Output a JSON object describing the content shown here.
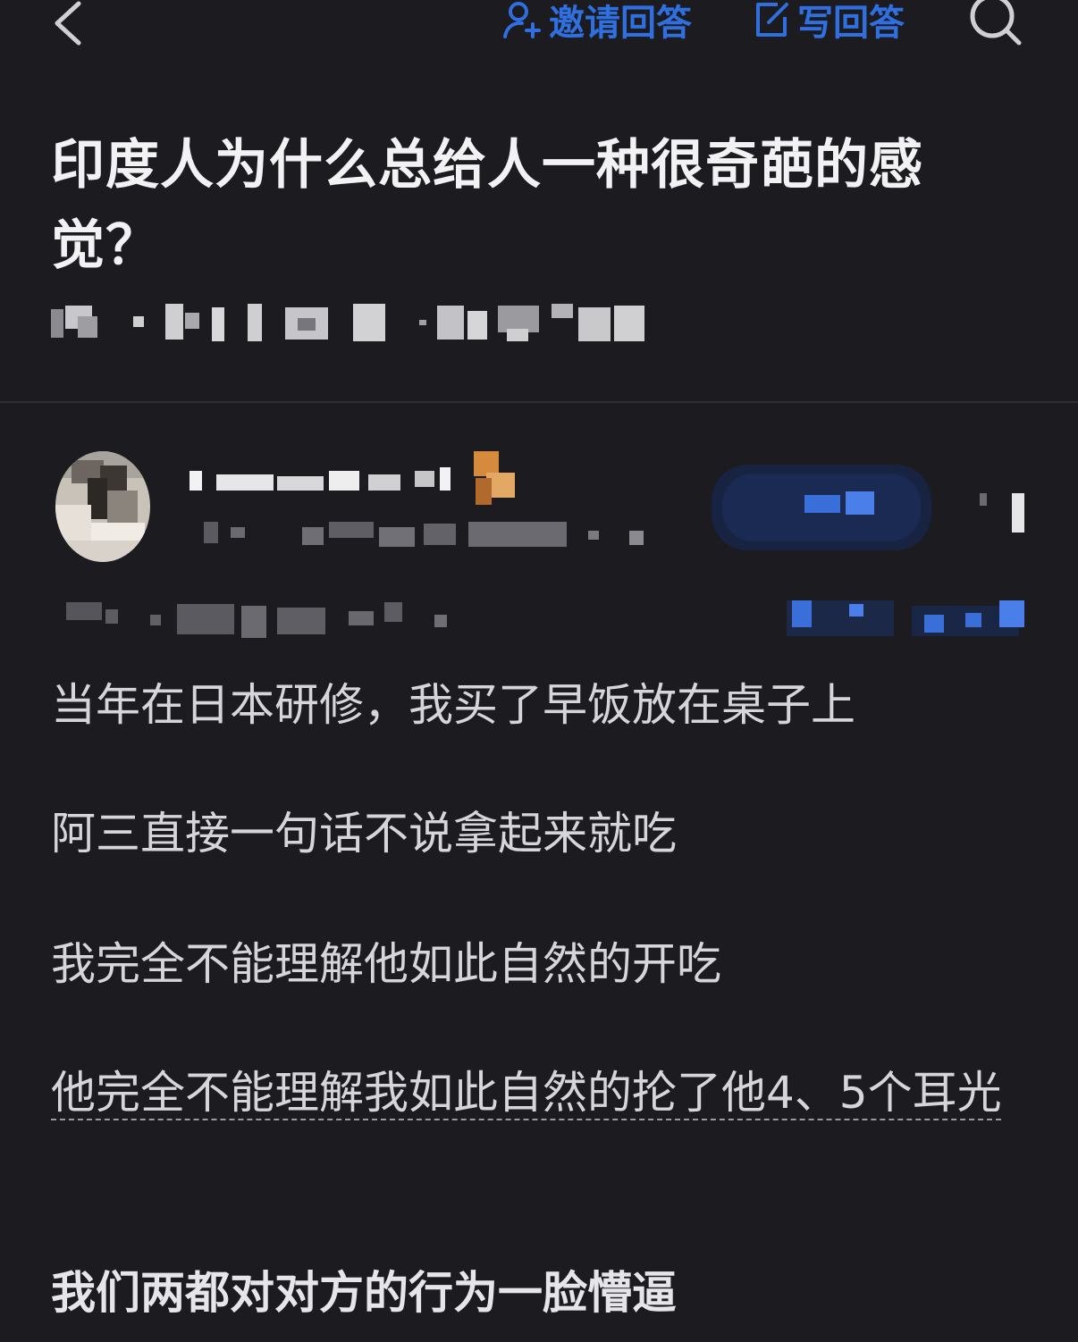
{
  "nav": {
    "invite_label": "邀请回答",
    "write_label": "写回答"
  },
  "colors": {
    "background": "#1b1b20",
    "accent": "#2f6fe0",
    "title": "#f2f2f4",
    "body_text": "#d6d6da"
  },
  "question": {
    "title": "印度人为什么总给人一种很奇葩的感觉？"
  },
  "answer": {
    "paragraphs": [
      "当年在日本研修，我买了早饭放在桌子上",
      "阿三直接一句话不说拿起来就吃",
      "我完全不能理解他如此自然的开吃",
      "他完全不能理解我如此自然的抡了他4、5个耳光",
      "我们两都对对方的行为一脸懵逼"
    ]
  },
  "icons": {
    "back": "chevron-left-icon",
    "invite": "user-plus-icon",
    "write": "edit-icon",
    "search": "search-icon"
  }
}
